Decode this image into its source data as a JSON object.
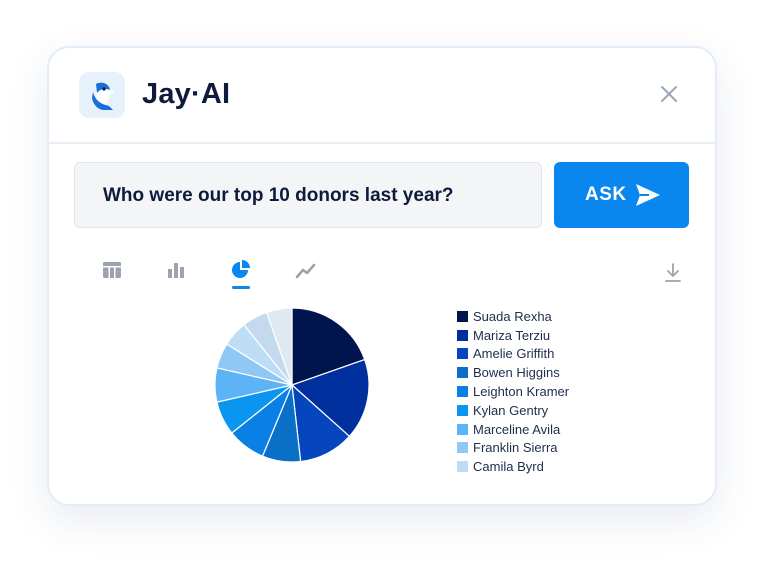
{
  "app": {
    "name": "Jay·AI",
    "logo_icon": "bluejay-logo-icon"
  },
  "header": {
    "close_icon": "close-icon"
  },
  "query": {
    "text": "Who were our top 10 donors last year?"
  },
  "ask_button": {
    "label": "ASK",
    "icon": "send-icon"
  },
  "view_tabs": [
    {
      "icon": "table-icon",
      "selected": false
    },
    {
      "icon": "bar-chart-icon",
      "selected": false
    },
    {
      "icon": "pie-chart-icon",
      "selected": true
    },
    {
      "icon": "line-chart-icon",
      "selected": false
    }
  ],
  "download_icon": "download-icon",
  "colors": {
    "accent": "#0a86ef",
    "title": "#0f1b3d"
  },
  "chart_data": {
    "type": "pie",
    "labels": [
      "Suada Rexha",
      "Mariza Terziu",
      "Amelie Griffith",
      "Bowen Higgins",
      "Leighton Kramer",
      "Kylan Gentry",
      "Marceline Avila",
      "Franklin Sierra",
      "Camila Byrd",
      "",
      ""
    ],
    "values": [
      22,
      19,
      13,
      9,
      9,
      8,
      8,
      6,
      6,
      6,
      6
    ],
    "colors": [
      "#00154d",
      "#002f9e",
      "#0545bd",
      "#0a6fc7",
      "#0a80e6",
      "#0a96f0",
      "#5cb3f5",
      "#8fc8f5",
      "#bddcf6",
      "#c4d9ee",
      "#e0e8f1"
    ],
    "legend": [
      {
        "name": "Suada Rexha",
        "color": "#00154d"
      },
      {
        "name": "Mariza Terziu",
        "color": "#002f9e"
      },
      {
        "name": "Amelie Griffith",
        "color": "#0545bd"
      },
      {
        "name": "Bowen Higgins",
        "color": "#0a6fc7"
      },
      {
        "name": "Leighton Kramer",
        "color": "#0a80e6"
      },
      {
        "name": "Kylan Gentry",
        "color": "#0a96f0"
      },
      {
        "name": "Marceline Avila",
        "color": "#5cb3f5"
      },
      {
        "name": "Franklin Sierra",
        "color": "#8fc8f5"
      },
      {
        "name": "Camila Byrd",
        "color": "#bddcf6"
      }
    ],
    "legend_position": "right"
  }
}
